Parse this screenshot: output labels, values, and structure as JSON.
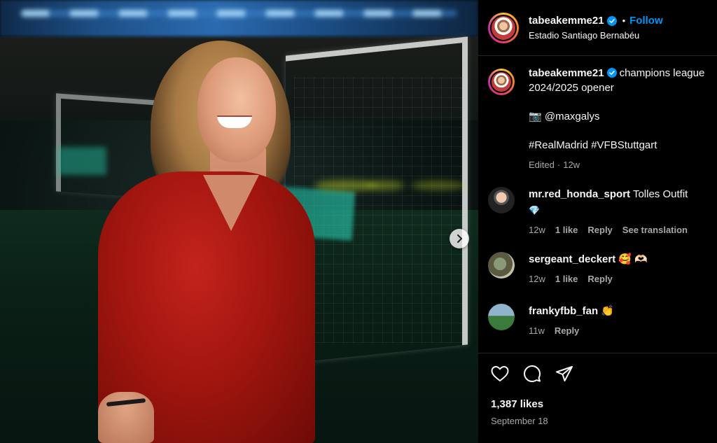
{
  "post": {
    "username": "tabeakemme21",
    "follow_label": "Follow",
    "separator": "•",
    "location": "Estadio Santiago Bernabéu",
    "caption": {
      "username": "tabeakemme21",
      "text": "champions league 2024/2025 opener",
      "camera_emoji": "📷",
      "photo_credit": "@maxgalys",
      "hashtags": "#RealMadrid #VFBStuttgart",
      "edited": "Edited",
      "dot": "·",
      "age": "12w"
    },
    "comments": [
      {
        "username": "mr.red_honda_sport",
        "text": "Tolles Outfit",
        "emoji": "💎",
        "age": "12w",
        "likes": "1 like",
        "reply": "Reply",
        "translate": "See translation"
      },
      {
        "username": "sergeant_deckert",
        "text": "",
        "emoji": "🥰 🫶🏻",
        "age": "12w",
        "likes": "1 like",
        "reply": "Reply"
      },
      {
        "username": "frankyfbb_fan",
        "text": "",
        "emoji": "👏",
        "age": "11w",
        "reply": "Reply"
      }
    ],
    "likes_count": "1,387 likes",
    "date": "September 18"
  },
  "icons": {
    "like": "heart-icon",
    "comment": "comment-icon",
    "share": "share-icon",
    "next": "chevron-right-icon",
    "verified": "verified-badge-icon"
  },
  "colors": {
    "background": "#000000",
    "text": "#f5f5f5",
    "muted": "#a8a8a8",
    "link": "#0095f6",
    "divider": "#262626"
  }
}
